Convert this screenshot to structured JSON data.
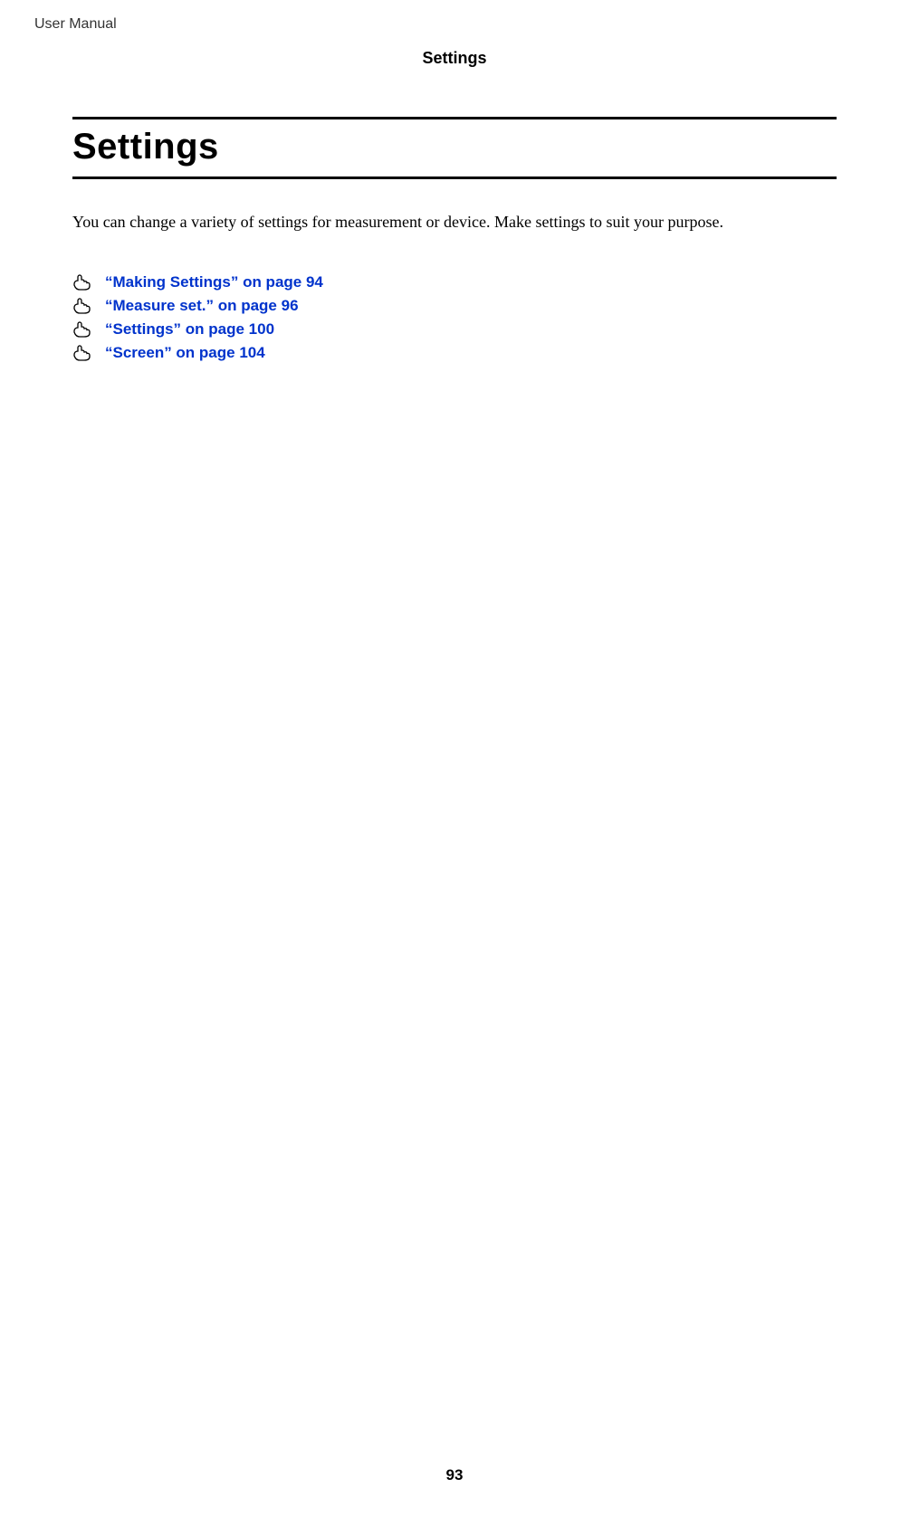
{
  "header": {
    "running_left": "User Manual",
    "running_center": "Settings"
  },
  "chapter": {
    "title": "Settings",
    "intro": "You can change a variety of settings for measurement or device. Make settings to suit your purpose."
  },
  "xrefs": [
    {
      "label": "“Making Settings” on page 94"
    },
    {
      "label": "“Measure set.” on page 96"
    },
    {
      "label": "“Settings” on page 100"
    },
    {
      "label": "“Screen” on page 104"
    }
  ],
  "page_number": "93"
}
